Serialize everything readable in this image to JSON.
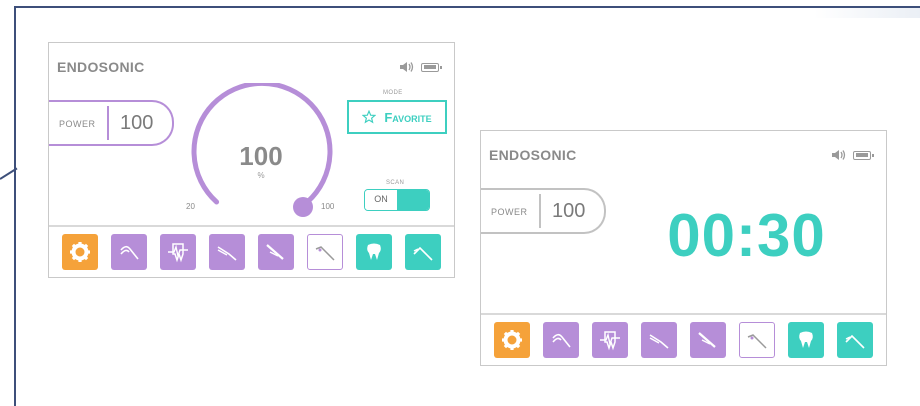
{
  "screen1": {
    "title": "ENDOSONIC",
    "power_label": "POWER",
    "power_value": "100",
    "dial": {
      "value": "100",
      "unit": "%",
      "min_label": "20",
      "max_label": "100",
      "level": 1.0
    },
    "mode_label": "MODE",
    "mode_value": "Favorite",
    "scan_label": "SCAN",
    "scan_toggle": "ON"
  },
  "screen2": {
    "title": "ENDOSONIC",
    "power_label": "POWER",
    "power_value": "100",
    "timer": "00:30"
  },
  "status_icons": [
    "speaker-icon",
    "battery-icon"
  ],
  "toolbar_icons": [
    {
      "name": "settings-gear-icon",
      "color": "orange"
    },
    {
      "name": "file-tip-icon",
      "color": "purple"
    },
    {
      "name": "tooth-ekg-icon",
      "color": "purple"
    },
    {
      "name": "retreatment-tip-icon",
      "color": "purple"
    },
    {
      "name": "cleaning-tip-icon",
      "color": "purple"
    },
    {
      "name": "perio-tip-icon",
      "color": "outline"
    },
    {
      "name": "tooth-icon",
      "color": "teal"
    },
    {
      "name": "scaler-tip-icon",
      "color": "teal"
    }
  ],
  "colors": {
    "purple": "#b68ed8",
    "teal": "#3dcfc0",
    "orange": "#f5a23a",
    "frame": "#3d4f7a"
  }
}
